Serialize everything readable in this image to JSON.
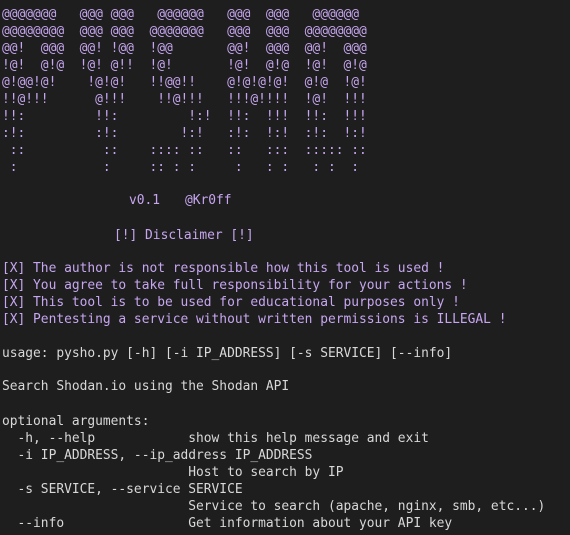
{
  "banner": [
    "@@@@@@@   @@@ @@@   @@@@@@   @@@  @@@   @@@@@@",
    "@@@@@@@@  @@@ @@@  @@@@@@@   @@@  @@@  @@@@@@@@",
    "@@!  @@@  @@! !@@  !@@       @@!  @@@  @@!  @@@",
    "!@!  @!@  !@! @!!  !@!       !@!  @!@  !@!  @!@",
    "@!@@!@!    !@!@!   !!@@!!    @!@!@!@!  @!@  !@!",
    "!!@!!!      @!!!    !!@!!!   !!!@!!!!  !@!  !!!",
    "!!:         !!:         !:!  !!:  !!!  !!:  !!!",
    ":!:         :!:        !:!   :!:  !:!  :!:  !:!",
    " ::          ::    :::: ::   ::   :::  ::::: ::",
    " :           :     :: : :     :   : :   : :  :"
  ],
  "version": "v0.1",
  "author": "@Kr0ff",
  "disclaimer_title": "[!] Disclaimer [!]",
  "disclaimers": [
    "[X] The author is not responsible how this tool is used !",
    "[X] You agree to take full responsibility for your actions !",
    "[X] This tool is to be used for educational purposes only !",
    "[X] Pentesting a service without written permissions is ILLEGAL !"
  ],
  "usage": "usage: pysho.py [-h] [-i IP_ADDRESS] [-s SERVICE] [--info]",
  "description": "Search Shodan.io using the Shodan API",
  "optional_header": "optional arguments:",
  "options": [
    "  -h, --help            show this help message and exit",
    "  -i IP_ADDRESS, --ip_address IP_ADDRESS",
    "                        Host to search by IP",
    "  -s SERVICE, --service SERVICE",
    "                        Service to search (apache, nginx, smb, etc...)",
    "  --info                Get information about your API key"
  ]
}
